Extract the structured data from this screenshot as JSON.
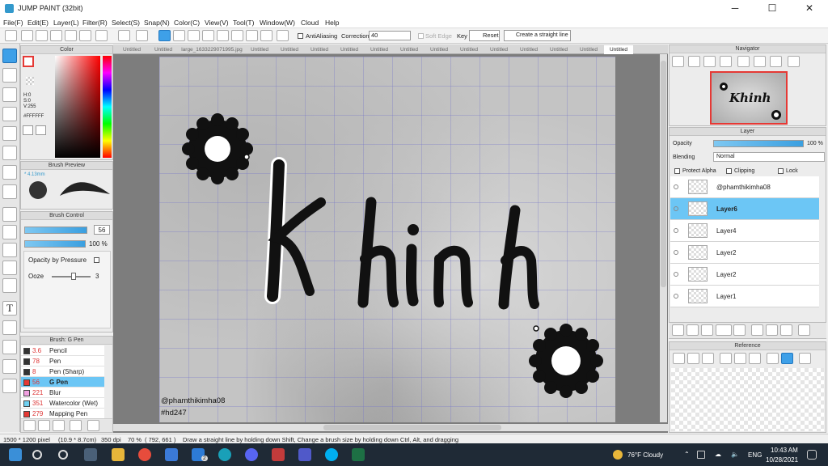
{
  "app": {
    "title": "JUMP PAINT (32bit)"
  },
  "window_controls": [
    "─",
    "☐",
    "✕"
  ],
  "menu": [
    "File(F)",
    "Edit(E)",
    "Layer(L)",
    "Filter(R)",
    "Select(S)",
    "Snap(N)",
    "Color(C)",
    "View(V)",
    "Tool(T)",
    "Window(W)",
    "Cloud",
    "Help"
  ],
  "toolbar": {
    "antialiasing_label": "AntiAliasing",
    "correction_label": "Correction",
    "correction_value": "40",
    "soft_edge_label": "Soft Edge",
    "key_label": "Key",
    "reset_label": "Reset",
    "straight_line_label": "Create a straight line"
  },
  "color_panel": {
    "title": "Color",
    "h": "H:0",
    "s": "S:0",
    "v": "V:255",
    "hex": "#FFFFFF"
  },
  "brush_preview": {
    "title": "Brush Preview",
    "size": "* 4.13mm"
  },
  "brush_control": {
    "title": "Brush Control",
    "size_value": "56",
    "opacity_value": "100 %",
    "opacity_by_pressure": "Opacity by Pressure",
    "ooze_label": "Ooze",
    "ooze_value": "3"
  },
  "brush_list": {
    "title": "Brush: G Pen",
    "items": [
      {
        "size": "3.6",
        "name": "Pencil",
        "color": "#333333"
      },
      {
        "size": "78",
        "name": "Pen",
        "color": "#333333"
      },
      {
        "size": "8",
        "name": "Pen (Sharp)",
        "color": "#333333"
      },
      {
        "size": "56",
        "name": "G Pen",
        "color": "#e53935"
      },
      {
        "size": "221",
        "name": "Blur",
        "color": "#f0a0e0"
      },
      {
        "size": "351",
        "name": "Watercolor (Wet)",
        "color": "#70d0f0"
      },
      {
        "size": "279",
        "name": "Mapping Pen",
        "color": "#e53935"
      }
    ]
  },
  "tabs": [
    "Untitled",
    "Untitled",
    "large_1633229071995.jpg",
    "Untitled",
    "Untitled",
    "Untitled",
    "Untitled",
    "Untitled",
    "Untitled",
    "Untitled",
    "Untitled",
    "Untitled",
    "Untitled",
    "Untitled",
    "Untitled",
    "Untitled"
  ],
  "canvas": {
    "word": "Khinh",
    "handle": "@phamthikimha08",
    "tag": "#hd247"
  },
  "navigator": {
    "title": "Navigator"
  },
  "layer_panel": {
    "title": "Layer",
    "opacity_label": "Opacity",
    "opacity_value": "100 %",
    "blending_label": "Blending",
    "blending_value": "Normal",
    "protect_alpha": "Protect Alpha",
    "clipping": "Clipping",
    "lock": "Lock",
    "layers": [
      "@phamthikimha08",
      "Layer6",
      "Layer4",
      "Layer2",
      "Layer2",
      "Layer1"
    ]
  },
  "reference": {
    "title": "Reference"
  },
  "status": {
    "size": "1500 * 1200 pixel",
    "dimension": "(10.9 * 8.7cm)",
    "dpi": "350 dpi",
    "zoom": "70 %",
    "coords": "( 792, 661 )",
    "hint": "Draw a straight line by holding down Shift, Change a brush size by holding down Ctrl, Alt, and dragging"
  },
  "taskbar": {
    "weather": "76°F Cloudy",
    "lang": "ENG",
    "time": "10:43 AM",
    "date": "10/28/2021",
    "mail_badge": "2"
  }
}
